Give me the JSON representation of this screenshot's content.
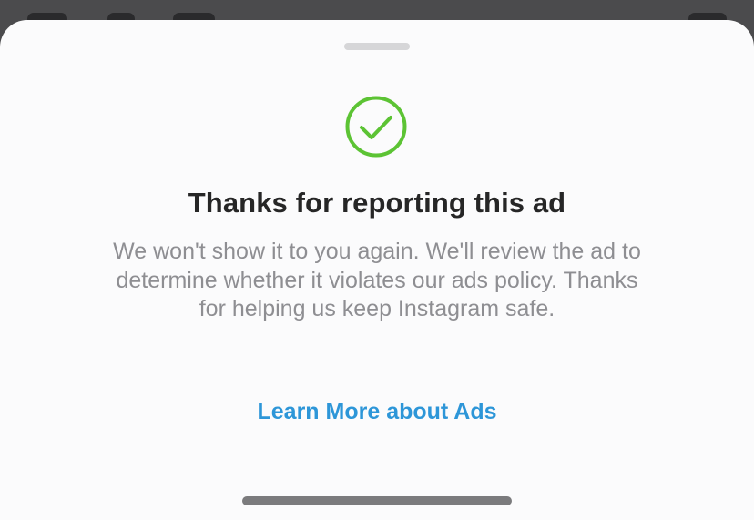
{
  "sheet": {
    "title": "Thanks for reporting this ad",
    "message": "We won't show it to you again. We'll review the ad to determine whether it violates our ads policy. Thanks for helping us keep Instagram safe.",
    "link_label": "Learn More about Ads"
  },
  "icons": {
    "status": "check-circle-icon"
  },
  "colors": {
    "success": "#5cc334",
    "link": "#2d96d8",
    "title": "#262626",
    "body": "#8e8e92",
    "sheet_background": "#fbfbfc"
  }
}
